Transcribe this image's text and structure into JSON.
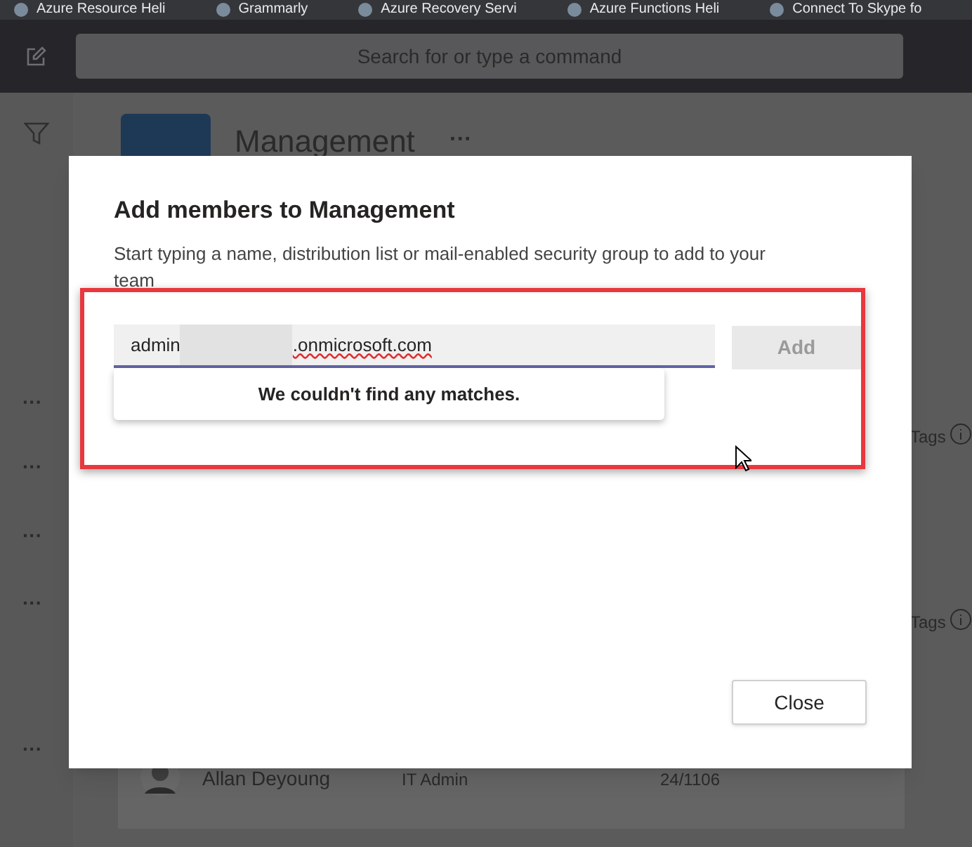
{
  "bookmarks": [
    {
      "label": "Azure Resource Heli"
    },
    {
      "label": "Grammarly"
    },
    {
      "label": "Azure Recovery Servi"
    },
    {
      "label": "Azure Functions Heli"
    },
    {
      "label": "Connect To Skype fo"
    }
  ],
  "search": {
    "placeholder": "Search for or type a command"
  },
  "team": {
    "name": "Management",
    "more": "···"
  },
  "row_menus": [
    "···",
    "···",
    "···",
    "···",
    "···"
  ],
  "tags_labels": [
    "Tags",
    "Tags"
  ],
  "member": {
    "name": "Allan Deyoung",
    "title": "IT Admin",
    "location": "24/1106"
  },
  "dialog": {
    "title": "Add members to Management",
    "description": "Start typing a name, distribution list or mail-enabled security group to add to your team",
    "input": {
      "value_start": "admin",
      "value_end": ".onmicrosoft.com",
      "redacted": true
    },
    "add_button": {
      "label": "Add",
      "disabled": true
    },
    "suggestion": "We couldn't find any matches.",
    "close_button": "Close"
  }
}
